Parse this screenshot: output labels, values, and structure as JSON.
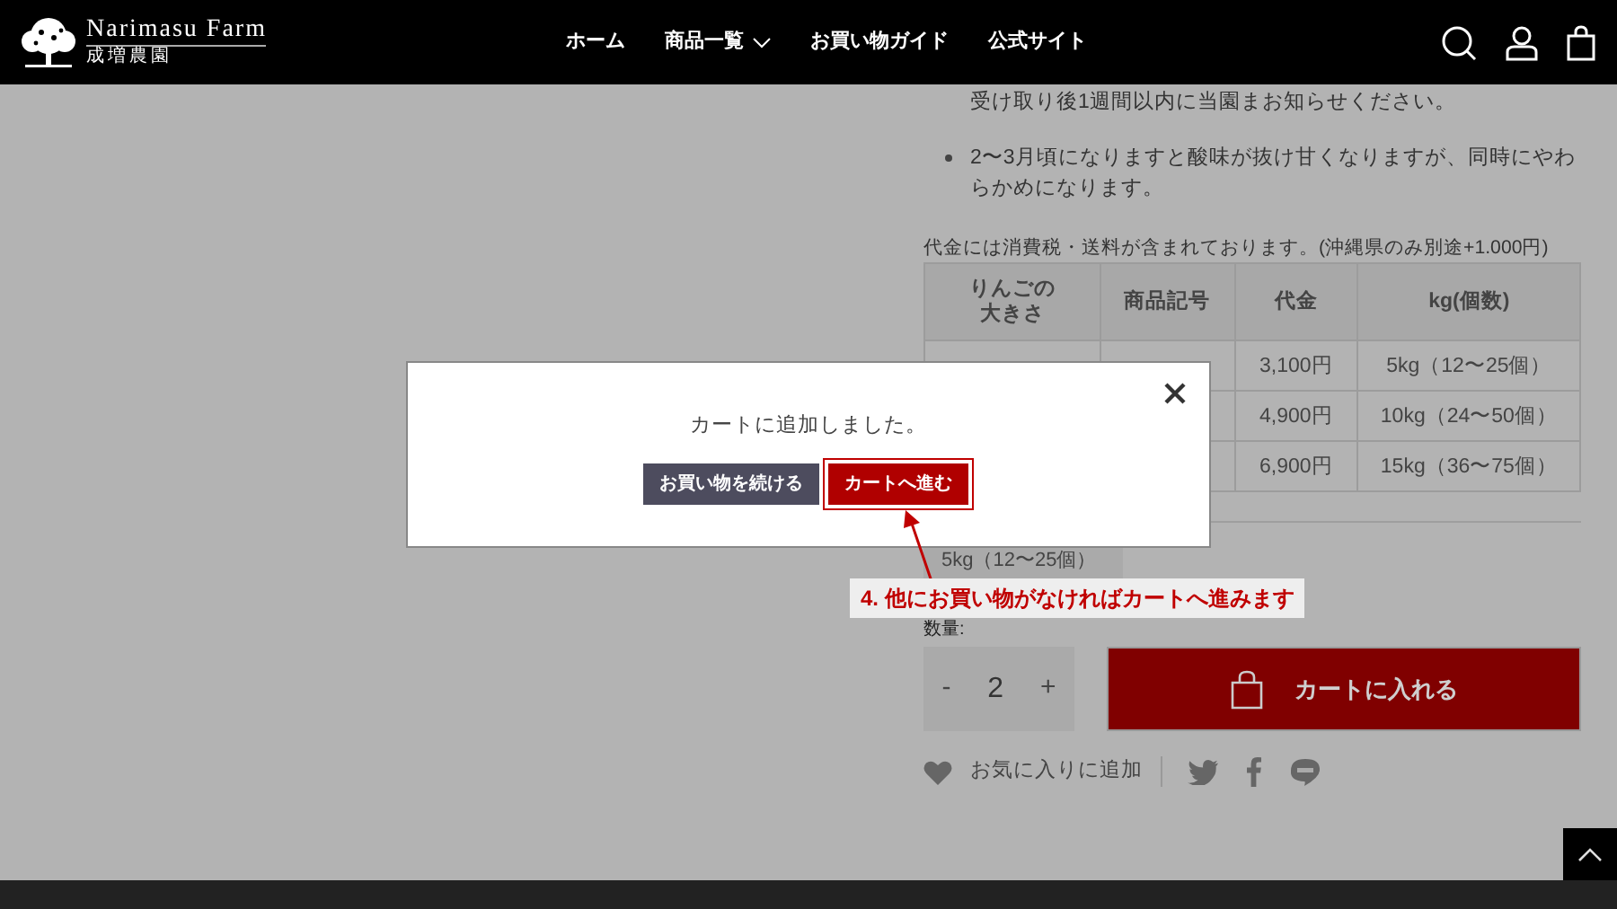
{
  "header": {
    "logo": {
      "name": "Narimasu Farm",
      "subtitle": "成増農園"
    },
    "nav": [
      {
        "label": "ホーム",
        "has_dropdown": false
      },
      {
        "label": "商品一覧",
        "has_dropdown": true
      },
      {
        "label": "お買い物ガイド",
        "has_dropdown": false
      },
      {
        "label": "公式サイト",
        "has_dropdown": false
      }
    ]
  },
  "notes": [
    {
      "kind": "continuation",
      "text": "受け取り後1週間以内に当園まお知らせください。"
    },
    {
      "kind": "bullet",
      "text": "2〜3月頃になりますと酸味が抜け甘くなりますが、同時にやわらかめになります。"
    }
  ],
  "price_note": "代金には消費税・送料が含まれております。(沖縄県のみ別途+1.000円)",
  "price_table": {
    "columns": [
      "りんごの大きさ",
      "商品記号",
      "代金",
      "kg(個数)"
    ],
    "rows": [
      {
        "price": "3,100円",
        "weight": "5kg（12〜25個）"
      },
      {
        "price": "4,900円",
        "weight": "10kg（24〜50個）"
      },
      {
        "price": "6,900円",
        "weight": "15kg（36〜75個）"
      }
    ]
  },
  "variant_select": {
    "value": "5kg（12〜25個）"
  },
  "quantity": {
    "label": "数量:",
    "minus": "-",
    "value": "2",
    "plus": "+"
  },
  "add_to_cart": "カートに入れる",
  "favorite": "お気に入りに追加",
  "modal": {
    "message": "カートに追加しました。",
    "buttons": [
      {
        "label": "お買い物を続ける",
        "kind": "secondary",
        "highlighted": false
      },
      {
        "label": "カートへ進む",
        "kind": "primary",
        "highlighted": true
      }
    ]
  },
  "annotation": "4. 他にお買い物がなければカートへ進みます"
}
